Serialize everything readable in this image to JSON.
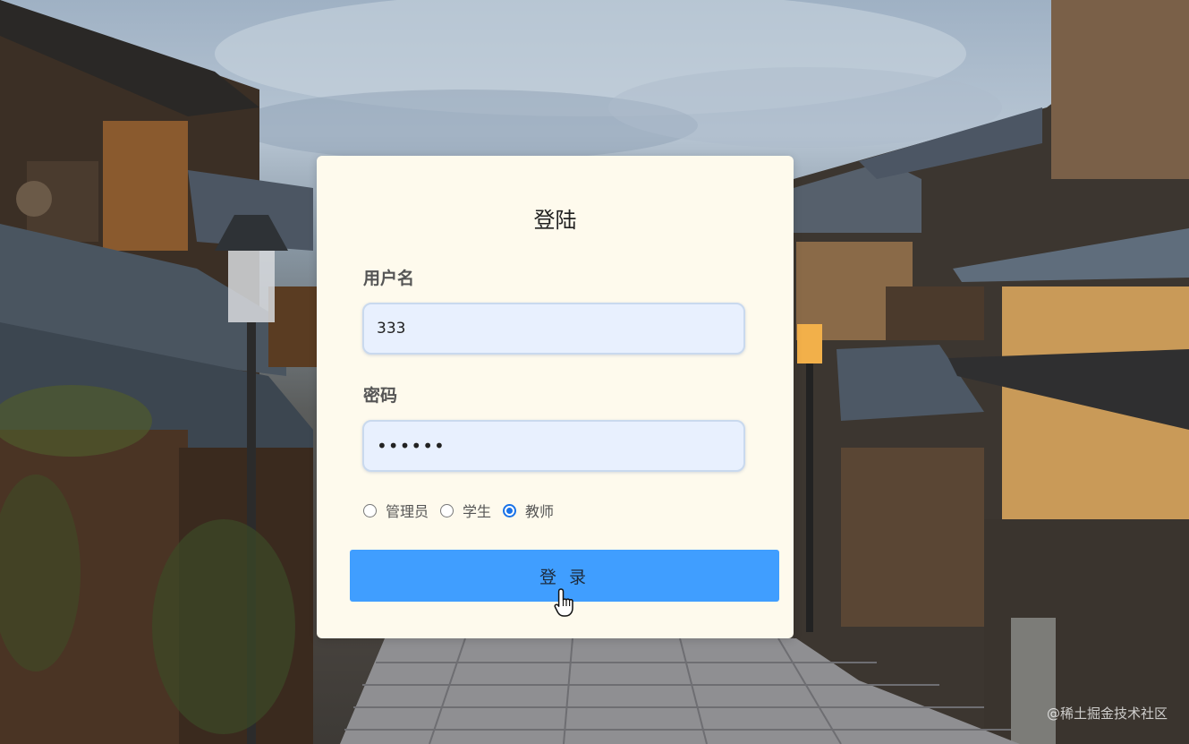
{
  "login": {
    "title": "登陆",
    "username_label": "用户名",
    "username_value": "333",
    "password_label": "密码",
    "password_value": "••••••",
    "roles": [
      {
        "label": "管理员",
        "checked": false
      },
      {
        "label": "学生",
        "checked": false
      },
      {
        "label": "教师",
        "checked": true
      }
    ],
    "submit_label": "登 录"
  },
  "watermark": "@稀土掘金技术社区",
  "colors": {
    "card_bg": "#fefaed",
    "input_bg": "#e8f0fe",
    "button_bg": "#409eff",
    "radio_checked": "#1a73e8"
  }
}
